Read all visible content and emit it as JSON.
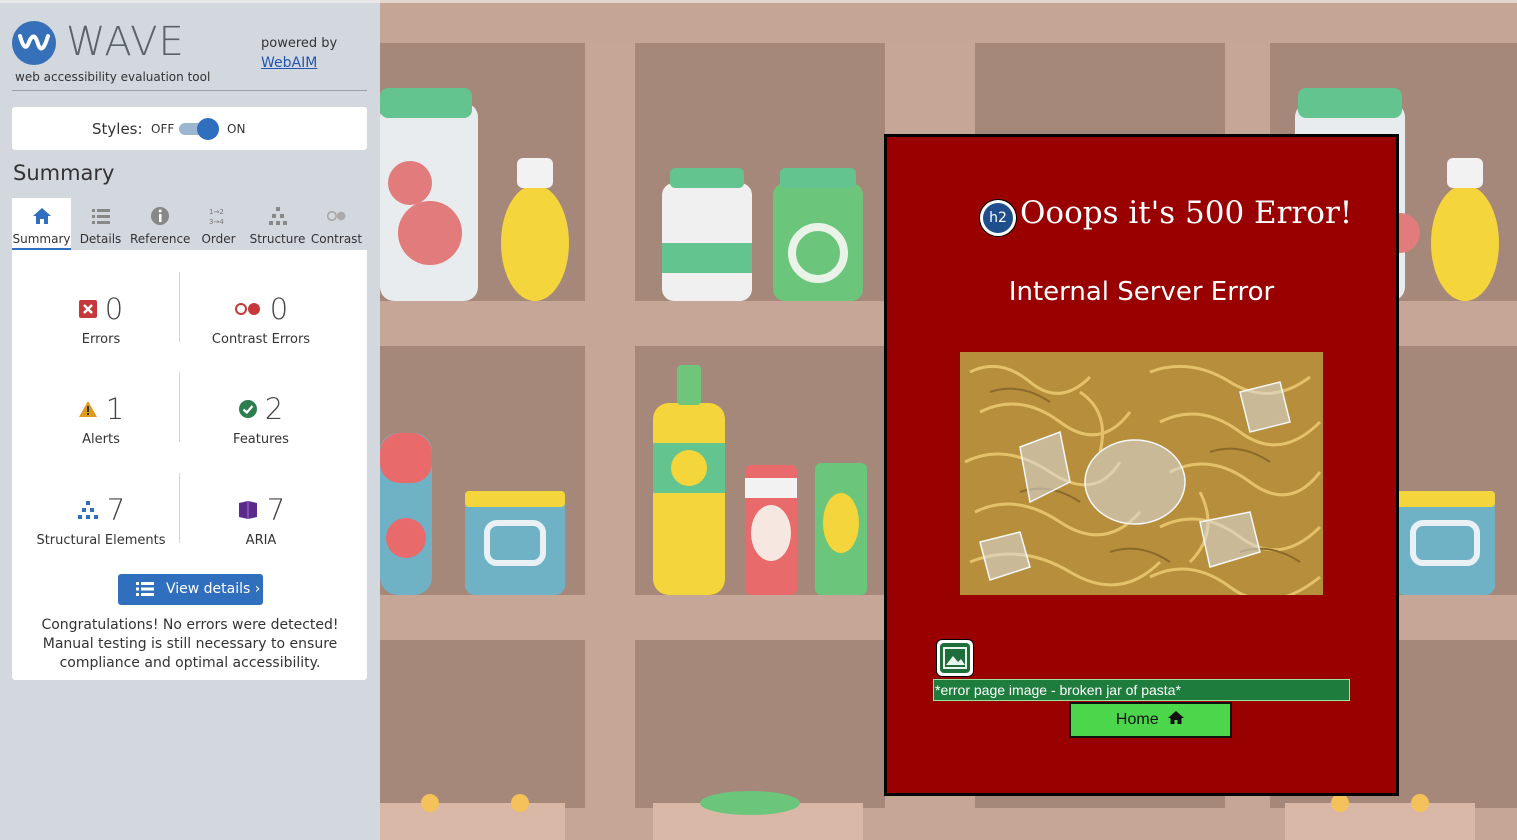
{
  "wave": {
    "title": "WAVE",
    "tagline": "web accessibility evaluation tool",
    "powered_by": "powered by",
    "webaim_link": "WebAIM",
    "styles_label": "Styles:",
    "styles_off": "OFF",
    "styles_on": "ON",
    "summary_heading": "Summary",
    "tabs": [
      {
        "label": "Summary",
        "icon": "home-icon",
        "active": true
      },
      {
        "label": "Details",
        "icon": "list-icon",
        "active": false
      },
      {
        "label": "Reference",
        "icon": "info-icon",
        "active": false
      },
      {
        "label": "Order",
        "icon": "order-icon",
        "active": false
      },
      {
        "label": "Structure",
        "icon": "structure-icon",
        "active": false
      },
      {
        "label": "Contrast",
        "icon": "contrast-icon",
        "active": false
      }
    ],
    "stats": {
      "errors": {
        "count": "0",
        "label": "Errors",
        "icon": "error-icon",
        "color": "#c43a3a"
      },
      "contrast_errors": {
        "count": "0",
        "label": "Contrast Errors",
        "icon": "contrast-error-icon",
        "color": "#c43a3a"
      },
      "alerts": {
        "count": "1",
        "label": "Alerts",
        "icon": "alert-icon",
        "color": "#e09a1a"
      },
      "features": {
        "count": "2",
        "label": "Features",
        "icon": "feature-check-icon",
        "color": "#2e7d4f"
      },
      "structural": {
        "count": "7",
        "label": "Structural Elements",
        "icon": "structure-icon",
        "color": "#2f6fbd"
      },
      "aria": {
        "count": "7",
        "label": "ARIA",
        "icon": "aria-icon",
        "color": "#5c2a8a"
      }
    },
    "view_details_label": "View details ›",
    "congrats": "Congratulations! No errors were detected! Manual testing is still necessary to ensure compliance and optimal accessibility."
  },
  "error_page": {
    "h2_badge": "h2",
    "title": "Ooops it's 500 Error!",
    "subtitle": "Internal Server Error",
    "image_icon": "image-icon",
    "alt_text": "*error page image - broken jar of pasta*",
    "home_label": "Home",
    "home_icon": "home-icon",
    "colors": {
      "card": "#990000",
      "button": "#4cd64c",
      "alt_bg": "#1e7d3d"
    }
  }
}
